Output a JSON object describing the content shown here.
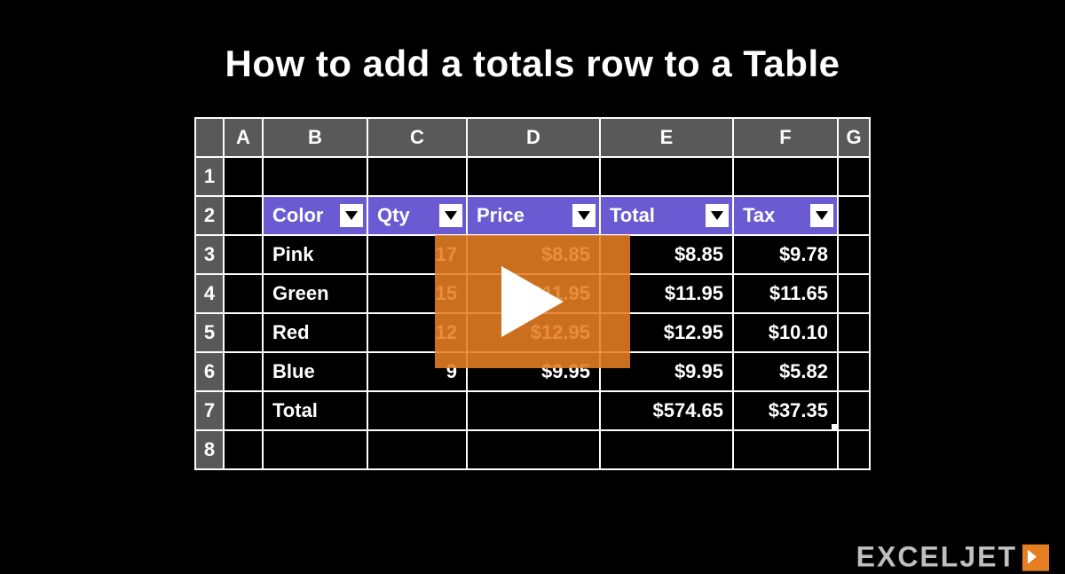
{
  "title": "How to add a totals row to a Table",
  "columns": [
    "A",
    "B",
    "C",
    "D",
    "E",
    "F",
    "G"
  ],
  "rowNumbers": [
    "1",
    "2",
    "3",
    "4",
    "5",
    "6",
    "7",
    "8"
  ],
  "tableHeaders": {
    "color": "Color",
    "qty": "Qty",
    "price": "Price",
    "total": "Total",
    "tax": "Tax"
  },
  "rows": [
    {
      "color": "Pink",
      "qty": "17",
      "price": "$8.85",
      "total": "$8.85",
      "tax": "$9.78"
    },
    {
      "color": "Green",
      "qty": "15",
      "price": "$11.95",
      "total": "$11.95",
      "tax": "$11.65"
    },
    {
      "color": "Red",
      "qty": "12",
      "price": "$12.95",
      "total": "$12.95",
      "tax": "$10.10"
    },
    {
      "color": "Blue",
      "qty": "9",
      "price": "$9.95",
      "total": "$9.95",
      "tax": "$5.82"
    }
  ],
  "totals": {
    "label": "Total",
    "total": "$574.65",
    "tax": "$37.35"
  },
  "watermark": "EXCELJET",
  "colors": {
    "tableHeader": "#6b5bd3",
    "playOverlay": "#e67e22"
  }
}
